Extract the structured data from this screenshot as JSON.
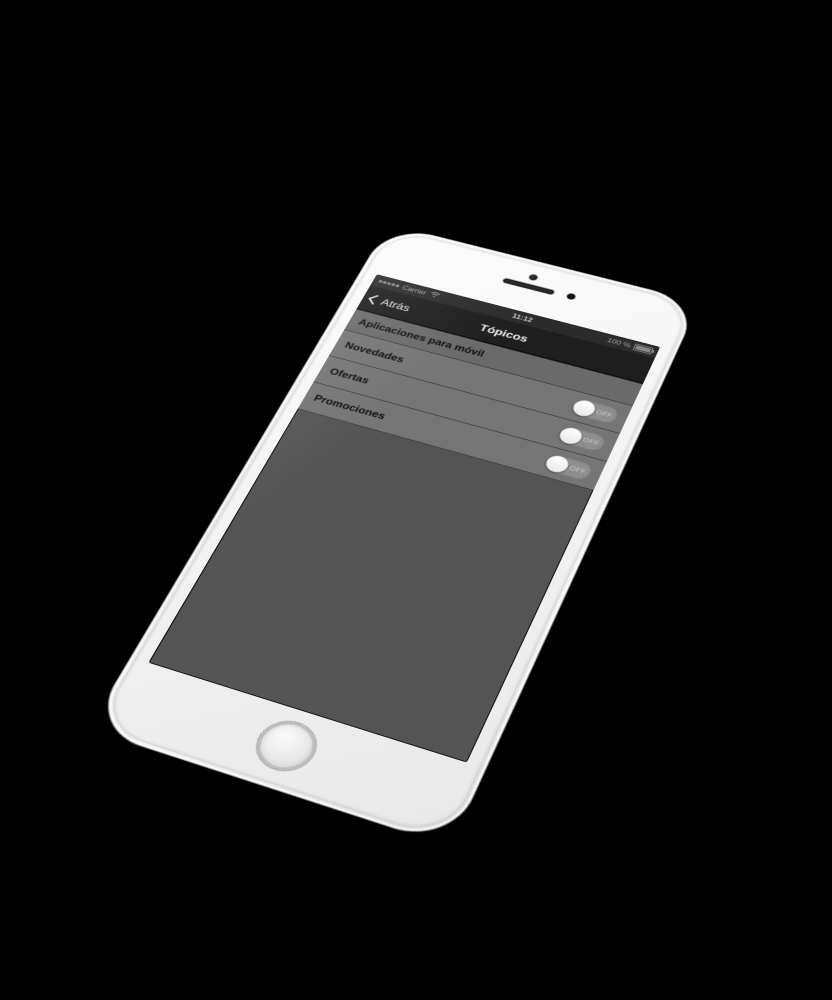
{
  "statusbar": {
    "carrier": "Carrier",
    "time": "11:12",
    "battery": "100 %"
  },
  "nav": {
    "back_label": "Atrás",
    "title": "Tópicos"
  },
  "section": {
    "header": "Aplicaciones para móvil",
    "toggle_off_label": "OFF",
    "rows": [
      {
        "label": "Novedades",
        "on": false
      },
      {
        "label": "Ofertas",
        "on": false
      },
      {
        "label": "Promociones",
        "on": false
      }
    ]
  }
}
